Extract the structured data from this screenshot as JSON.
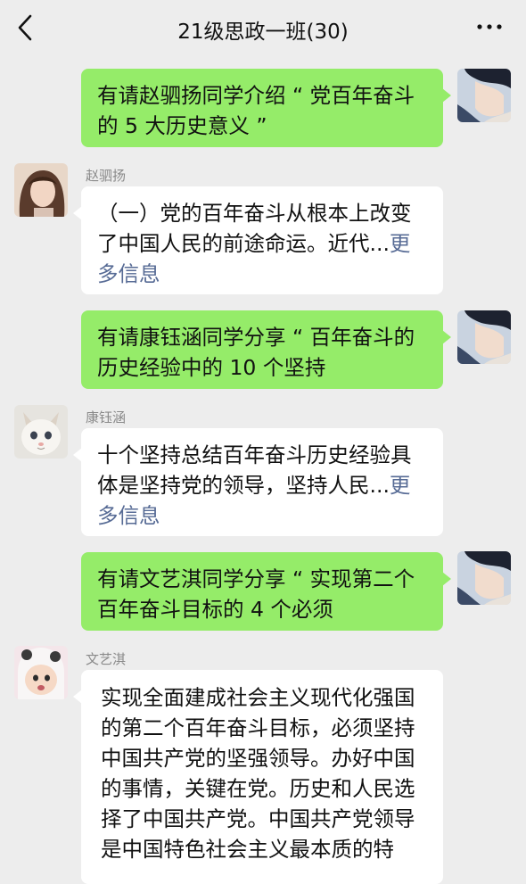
{
  "header": {
    "title": "21级思政一班(30)"
  },
  "messages": [
    {
      "text": "有请赵驷扬同学介绍 “ 党百年奋斗的 5 大历史意义 ”"
    },
    {
      "sender": "赵驷扬",
      "text": "（一）党的百年奋斗从根本上改变了中国人民的前途命运。近代...",
      "more": "更多信息"
    },
    {
      "text": "有请康钰涵同学分享 “ 百年奋斗的历史经验中的 10 个坚持"
    },
    {
      "sender": "康钰涵",
      "text": "十个坚持总结百年奋斗历史经验具体是坚持党的领导，坚持人民...",
      "more": "更多信息"
    },
    {
      "text": "有请文艺淇同学分享 “ 实现第二个百年奋斗目标的 4 个必须"
    },
    {
      "sender": "文艺淇",
      "text": "实现全面建成社会主义现代化强国的第二个百年奋斗目标，必须坚持中国共产党的坚强领导。办好中国的事情，关键在党。历史和人民选择了中国共产党。中国共产党领导是中国特色社会主义最本质的特"
    }
  ],
  "colors": {
    "outgoing_bubble": "#95ec69",
    "incoming_bubble": "#ffffff",
    "background": "#ededed",
    "link": "#576b95"
  }
}
